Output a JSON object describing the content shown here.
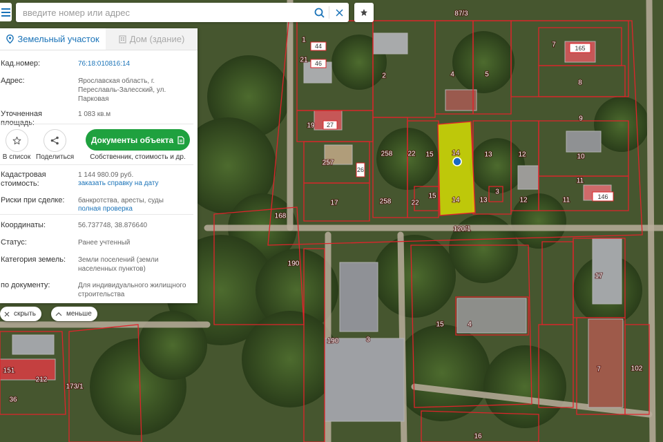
{
  "search": {
    "placeholder": "введите номер или адрес"
  },
  "tabs": [
    {
      "label": "Земельный участок",
      "active": true
    },
    {
      "label": "Дом (здание)",
      "active": false
    }
  ],
  "parcel": {
    "cadastral_number_label": "Кад.номер:",
    "cadastral_number": "76:18:010816:14",
    "address_label": "Адрес:",
    "address": "Ярославская область, г. Переславль-Залесский, ул. Парковая",
    "area_label": "Уточненная площадь:",
    "area": "1 083 кв.м",
    "cadastral_value_label": "Кадастровая стоимость:",
    "cadastral_value": "1 144 980.09 руб.",
    "cadastral_value_link": "заказать справку на дату",
    "risks_label": "Риски при сделке:",
    "risks": "банкротства, аресты, суды",
    "risks_link": "полная проверка",
    "coords_label": "Координаты:",
    "coords": "56.737748, 38.876640",
    "status_label": "Статус:",
    "status": "Ранее учтенный",
    "land_category_label": "Категория земель:",
    "land_category": "Земли поселений (земли населенных пунктов)",
    "by_document_label": "по документу:",
    "by_document": "Для индивидуального жилищного строительства"
  },
  "actions": {
    "favorites_label": "В список",
    "share_label": "Поделиться",
    "documents_label": "Документы объекта",
    "documents_sub": "Собственник, стоимость и др."
  },
  "pills": {
    "hide": "скрыть",
    "less": "меньше"
  },
  "map_labels": {
    "l_87_3": "87/3",
    "l_1": "1",
    "l_44": "44",
    "l_21": "21",
    "l_46": "46",
    "l_2": "2",
    "l_4": "4",
    "l_5": "5",
    "l_7": "7",
    "l_165": "165",
    "l_8": "8",
    "l_9": "9",
    "l_19": "19",
    "l_27": "27",
    "l_258a": "258",
    "l_22a": "22",
    "l_15a": "15",
    "l_14a": "14",
    "l_13a": "13",
    "l_12a": "12",
    "l_10": "10",
    "l_257": "257",
    "l_26": "26",
    "l_11a": "11",
    "l_17a": "17",
    "l_258b": "258",
    "l_22b": "22",
    "l_15b": "15",
    "l_14b": "14",
    "l_13b": "13",
    "l_3": "3",
    "l_12b": "12",
    "l_11b": "11",
    "l_146": "146",
    "l_168": "168",
    "l_120_1": "120/1",
    "l_190a": "190",
    "l_17b": "17",
    "l_15c": "15",
    "l_4b": "4",
    "l_190b": "190",
    "l_3b": "3",
    "l_7b": "7",
    "l_102": "102",
    "l_151": "151",
    "l_212": "212",
    "l_173_1": "173/1",
    "l_36": "36",
    "l_16": "16"
  },
  "colors": {
    "parcel_border": "#e0242b",
    "selected_parcel": "#e0e800",
    "accent_blue": "#1a73b8",
    "button_green": "#1fa13f",
    "pin_blue": "#1868c4"
  }
}
